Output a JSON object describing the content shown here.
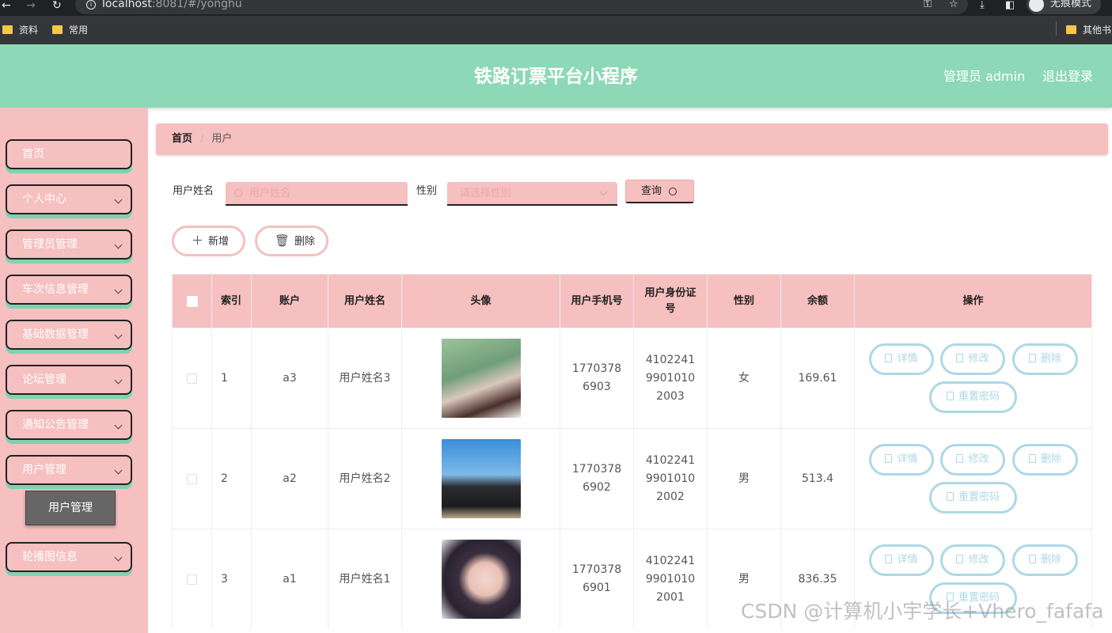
{
  "browser": {
    "url_host": "localhost",
    "url_rest": ":8081/#/yonghu",
    "incognito_label": "无痕模式",
    "bookmarks": [
      "资料",
      "常用",
      "其他书"
    ]
  },
  "header": {
    "title": "铁路订票平台小程序",
    "user": "管理员 admin",
    "logout": "退出登录"
  },
  "sidebar": {
    "items": [
      {
        "label": "首页"
      },
      {
        "label": "个人中心"
      },
      {
        "label": "管理员管理"
      },
      {
        "label": "车次信息管理"
      },
      {
        "label": "基础数据管理"
      },
      {
        "label": "论坛管理"
      },
      {
        "label": "通知公告管理"
      },
      {
        "label": "用户管理"
      },
      {
        "label": "轮播图信息"
      }
    ],
    "submenu_active": "用户管理"
  },
  "breadcrumb": {
    "home": "首页",
    "separator": "/",
    "current": "用户"
  },
  "search": {
    "name_label": "用户姓名",
    "name_placeholder": "用户姓名",
    "gender_label": "性别",
    "gender_placeholder": "请选择性别",
    "query_button": "查询"
  },
  "actions": {
    "add": "新增",
    "delete": "删除"
  },
  "table": {
    "columns": [
      "索引",
      "账户",
      "用户姓名",
      "头像",
      "用户手机号",
      "用户身份证号",
      "性别",
      "余额",
      "操作"
    ],
    "row_buttons": {
      "detail": "详情",
      "edit": "修改",
      "delete": "删除",
      "reset": "重置密码"
    },
    "rows": [
      {
        "index": "1",
        "account": "a3",
        "name": "用户姓名3",
        "phone": "17703786903",
        "id_card": "410224199010102003",
        "gender": "女",
        "balance": "169.61"
      },
      {
        "index": "2",
        "account": "a2",
        "name": "用户姓名2",
        "phone": "17703786902",
        "id_card": "410224199010102002",
        "gender": "男",
        "balance": "513.4"
      },
      {
        "index": "3",
        "account": "a1",
        "name": "用户姓名1",
        "phone": "17703786901",
        "id_card": "410224199010102001",
        "gender": "男",
        "balance": "836.35"
      }
    ]
  },
  "watermark": "CSDN @计算机小宇学长+Vhero_fafafa",
  "colors": {
    "header": "#8dd8b6",
    "pink": "#f6bfc0",
    "action_blue": "#add8e6",
    "menu_shadow": "#7fd2b0"
  }
}
